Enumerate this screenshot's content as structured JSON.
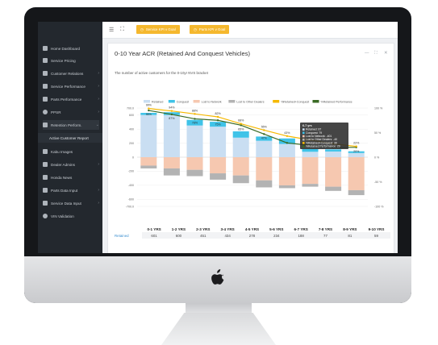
{
  "app": {
    "sidebar": {
      "items": [
        {
          "label": "Home Dashboard",
          "icon": "home-icon",
          "chevron": false
        },
        {
          "label": "Service Pricing",
          "icon": "star-icon",
          "chevron": false
        },
        {
          "label": "Customer Relations",
          "icon": "gear-icon",
          "chevron": true
        },
        {
          "label": "Service Performance",
          "icon": "bar-chart-icon",
          "chevron": true
        },
        {
          "label": "Parts Performance",
          "icon": "tag-icon",
          "chevron": true
        },
        {
          "label": "PPSR",
          "icon": "circle-icon",
          "chevron": true
        },
        {
          "label": "Retention Perform.",
          "icon": "retention-icon",
          "chevron": true
        }
      ],
      "sub_item": "Active Customer Report",
      "items_after": [
        {
          "label": "Kabu Images",
          "icon": "image-icon",
          "chevron": false
        },
        {
          "label": "Dealer Admins",
          "icon": "table-icon",
          "chevron": true
        },
        {
          "label": "Honda News",
          "icon": "news-icon",
          "chevron": false
        },
        {
          "label": "Parts Data Input",
          "icon": "pencil-icon",
          "chevron": true
        },
        {
          "label": "Service Data Input",
          "icon": "pencil-icon",
          "chevron": true
        },
        {
          "label": "VIN Validation",
          "icon": "search-icon",
          "chevron": false
        }
      ]
    },
    "topbar": {
      "btn1": "Service KPI v Goal",
      "btn2": "Parts KPI v Goal"
    },
    "card": {
      "title": "0-10 Year ACR (Retained And Conquest Vehicles)",
      "subtitle": "The number of active customers for the 0-10yr NVS bracket"
    }
  },
  "chart_data": {
    "type": "bar",
    "categories": [
      "0-1 yrs",
      "1-2 yrs",
      "2-3 yrs",
      "3-4 yrs",
      "4-5 yrs",
      "5-6 yrs",
      "6-7 yrs",
      "7-8 yrs",
      "8-9 yrs",
      "9-10 yrs"
    ],
    "legend": [
      "Retained",
      "Conquest",
      "Lost to Network",
      "Lost to Other Dealers",
      "%Retained+Conquest",
      "%Retained Performance"
    ],
    "colors": {
      "retained": "#c9def2",
      "conquest": "#3fc3e8",
      "lost_network": "#f6c8b0",
      "lost_other": "#b3b3b3",
      "line_rc": "#f5b800",
      "line_ret": "#3a6a24"
    },
    "series": [
      {
        "name": "Retained",
        "values": [
          601,
          600,
          451,
          434,
          278,
          234,
          188,
          77,
          81,
          59
        ]
      },
      {
        "name": "Conquest",
        "values": [
          30,
          40,
          80,
          70,
          90,
          60,
          79,
          40,
          30,
          25
        ]
      },
      {
        "name": "Lost to Network",
        "values": [
          -120,
          -160,
          -180,
          -230,
          -260,
          -330,
          -401,
          -380,
          -420,
          -470
        ]
      },
      {
        "name": "Lost to Other Dealers",
        "values": [
          -40,
          -100,
          -90,
          -90,
          -110,
          -100,
          -40,
          -40,
          -60,
          -70
        ]
      }
    ],
    "line_rc_pct": [
      99,
      94,
      88,
      82,
      68,
      55,
      43,
      35,
      27,
      22
    ],
    "line_ret_pct": [
      95,
      87,
      78,
      75,
      65,
      47,
      29,
      24,
      20,
      20
    ],
    "line_rc_labels": [
      "99%",
      "94%",
      "88%",
      "82%",
      "68%",
      "55%",
      "43%",
      "",
      "",
      "22%"
    ],
    "line_ret_labels": [
      "95%",
      "87%",
      "78%",
      "75%",
      "65%",
      "47%",
      "",
      "",
      "",
      "20%"
    ],
    "ylim": [
      -700,
      700
    ],
    "y_ticks": [
      "700.0",
      "600",
      "400",
      "200",
      "0",
      "-200",
      "-400",
      "-600",
      "-700.0"
    ],
    "y2_ticks": [
      "100 %",
      "50 %",
      "0 %",
      "-50 %",
      "-100 %"
    ],
    "tooltip": {
      "title": "6-7 yrs",
      "lines": [
        "Retained: 87",
        "Conquest: 79",
        "Lost to Network: -401",
        "Lost to Other Dealers: -40",
        "%Retained+Conquest: 39",
        "%Retained Performance: 29"
      ]
    },
    "table": {
      "headers": [
        "0-1 YRS",
        "1-2 YRS",
        "2-3 YRS",
        "3-4 YRS",
        "4-5 YRS",
        "5-6 YRS",
        "6-7 YRS",
        "7-8 YRS",
        "8-9 YRS",
        "9-10 YRS"
      ],
      "row_label": "Retained",
      "values": [
        "601",
        "600",
        "451",
        "434",
        "278",
        "234",
        "188",
        "77",
        "81",
        "59"
      ]
    }
  }
}
